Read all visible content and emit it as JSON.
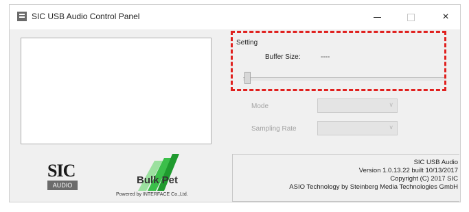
{
  "window": {
    "title": "SIC USB Audio Control Panel",
    "minimize_icon": "minimize-icon",
    "maximize_icon": "maximize-icon",
    "close_glyph": "×"
  },
  "logos": {
    "sic_text": "SIC",
    "sic_sub": "AUDIO",
    "bulk_text": "Bulk Pet",
    "powered_by": "Powered by INTERFACE Co.,Ltd."
  },
  "setting": {
    "group_label": "Setting",
    "buffer_size_label": "Buffer Size:",
    "buffer_size_value": "----",
    "slider_level": 0
  },
  "mode": {
    "label": "Mode",
    "value": ""
  },
  "sampling_rate": {
    "label": "Sampling Rate",
    "value": ""
  },
  "info": {
    "line1": "SIC USB Audio",
    "line2": "Version 1.0.13.22  built 10/13/2017",
    "line3": "Copyright (C) 2017 SIC",
    "line4": "ASIO Technology by Steinberg Media Technologies GmbH"
  },
  "colors": {
    "highlight_dash": "#e0201e",
    "bulk_green": "#3bbf4a"
  }
}
